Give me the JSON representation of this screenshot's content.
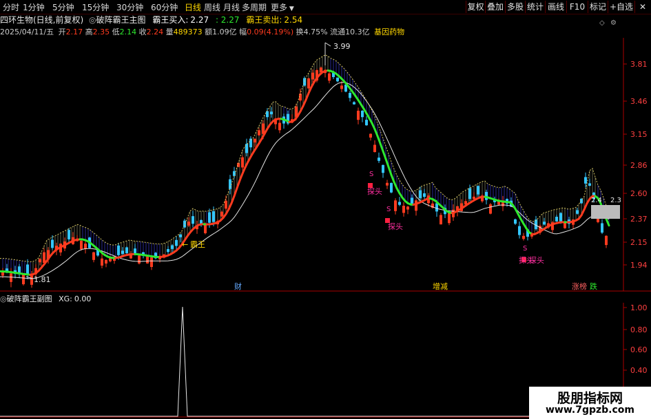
{
  "periods": [
    {
      "label": "分时",
      "active": false
    },
    {
      "label": "1分钟",
      "active": false
    },
    {
      "label": "5分钟",
      "active": false
    },
    {
      "label": "15分钟",
      "active": false
    },
    {
      "label": "30分钟",
      "active": false
    },
    {
      "label": "60分钟",
      "active": false
    },
    {
      "label": "日线",
      "active": true
    },
    {
      "label": "周线",
      "active": false
    },
    {
      "label": "月线",
      "active": false
    },
    {
      "label": "多周期",
      "active": false
    },
    {
      "label": "更多",
      "active": false
    }
  ],
  "right_buttons": [
    "复权",
    "叠加",
    "多股",
    "统计",
    "画线",
    "F10",
    "标记",
    "+自选"
  ],
  "indicator_bar": {
    "stock": "四环生物(日线,前复权)",
    "formula": "破阵霸王主图",
    "buy_label": "霸王买入:",
    "buy_value": "2.27",
    "buy_extra": "2.27",
    "sell_label": "霸王卖出:",
    "sell_value": "2.54"
  },
  "info_bar": {
    "date": "2025/04/11/五",
    "open_label": "开",
    "open": "2.17",
    "high_label": "高",
    "high": "2.35",
    "low_label": "低",
    "low": "2.14",
    "close_label": "收",
    "close": "2.24",
    "vol_label": "量",
    "vol": "489373",
    "amt_label": "额",
    "amt": "1.09亿",
    "chg_label": "幅",
    "chg": "0.09(4.19%)",
    "turn_label": "换",
    "turn": "4.75%",
    "float_label": "流通",
    "float": "10.3亿",
    "sector": "基因药物"
  },
  "sub_chart": {
    "formula": "破阵霸王副图",
    "value_label": "XG:",
    "value": "0.00",
    "yaxis": [
      "1.00",
      "0.80",
      "0.60",
      "0.40",
      "0.20"
    ]
  },
  "main_chart": {
    "yaxis": [
      "3.81",
      "3.46",
      "3.15",
      "2.86",
      "2.60",
      "2.37",
      "2.15",
      "1.94"
    ],
    "high_mark": "3.99",
    "low_mark": "1.81",
    "current_label": "2.4",
    "current_label2": "2.3",
    "buy_annot": "霸王",
    "signals": [
      "S",
      "S",
      "S",
      "S",
      "S",
      "S"
    ],
    "dip_labels": [
      "探头",
      "探头",
      "探头",
      "探头"
    ],
    "events": [
      "财",
      "增减",
      "涨榜",
      "跌"
    ]
  },
  "colors": {
    "up": "#ff3b1f",
    "down": "#33c6ff",
    "ma_up": "#ff3b1f",
    "ma_down": "#2ee82e",
    "signal": "#ff2fa0",
    "yellow": "#ffd700",
    "axis_red": "#aa0000"
  },
  "watermark": {
    "line1": "股朋指标网",
    "line2": "www.7gpzb.com"
  }
}
